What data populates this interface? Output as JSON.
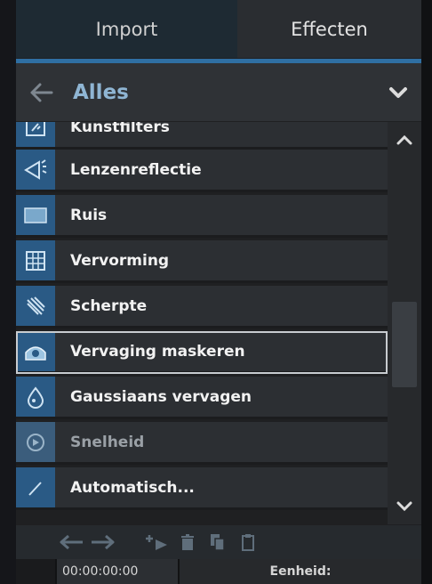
{
  "tabs": [
    {
      "label": "Import",
      "active": false
    },
    {
      "label": "Effecten",
      "active": true
    }
  ],
  "header": {
    "title": "Alles",
    "back_icon": "arrow-left-icon",
    "dropdown_icon": "chevron-down-icon"
  },
  "list": {
    "items": [
      {
        "label": "Kunstfilters",
        "icon": "art-filter-icon"
      },
      {
        "label": "Lenzenreflectie",
        "icon": "lens-flare-icon"
      },
      {
        "label": "Ruis",
        "icon": "noise-icon"
      },
      {
        "label": "Vervorming",
        "icon": "distortion-grid-icon"
      },
      {
        "label": "Scherpte",
        "icon": "sharpness-icon"
      },
      {
        "label": "Vervaging maskeren",
        "icon": "mask-blur-icon",
        "selected": true
      },
      {
        "label": "Gaussiaans vervagen",
        "icon": "gaussian-drop-icon"
      },
      {
        "label": "Snelheid",
        "icon": "speed-icon",
        "dim": true
      },
      {
        "label": "Automatisch...",
        "icon": "partial-item-icon",
        "partial": true
      }
    ]
  },
  "status": {
    "timecode": "00:00:00:00",
    "unit_label": "Eenheid:"
  },
  "colors": {
    "accent": "#2f6fa3",
    "header_title": "#8fb5d3",
    "icon_bg": "#2a5a85"
  }
}
